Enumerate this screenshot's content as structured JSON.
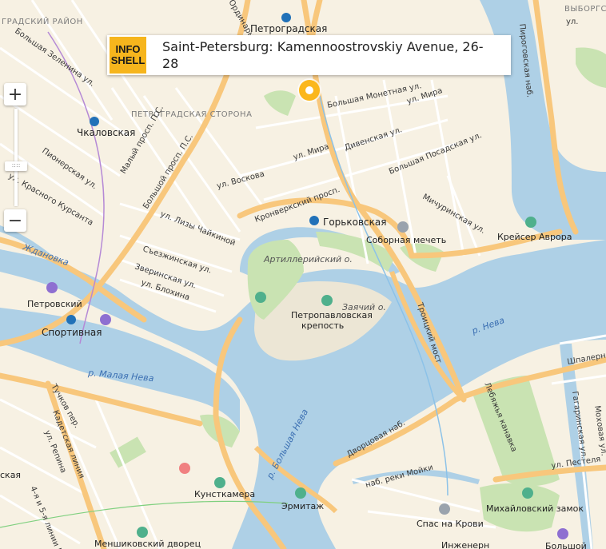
{
  "info_card": {
    "logo_line1": "INFO",
    "logo_line2": "SHELL",
    "title": "Saint-Petersburg: Kamennoostrovskiy Avenue, 26-28"
  },
  "zoom": {
    "plus": "+",
    "minus": "−",
    "handle": "::::"
  },
  "colors": {
    "land": "#f7f1e3",
    "water": "#aed0e6",
    "park": "#c9e3b2",
    "road_major": "#f8c77c",
    "road_minor": "#ffffff",
    "marker": "#fbb71c",
    "logo": "#f6b51d"
  },
  "labels": {
    "district_top": "ГРАДСКИЙ РАЙОН",
    "district_vyborg": "ВЫБОРГСК",
    "district_petrograd": "ПЕТРОГРАДСКАЯ СТОРОНА",
    "metro_petrogradskaya": "Петроградская",
    "metro_chkalovskaya": "Чкаловская",
    "metro_gorkovskaya": "Горьковская",
    "metro_sportivnaya": "Спортивная",
    "petrovsky": "Петровский",
    "street_bolshaya_zelenina": "Большая Зеленина ул.",
    "street_bolshoy_pr": "Большой просп. П.С.",
    "street_pionerskaya": "Пионерская ул.",
    "street_krasnogo_kursanta": "ул. Красного Курсанта",
    "street_maly_pr": "Малый просп. П.С.",
    "street_voskova": "ул. Воскова",
    "street_mira1": "ул. Мира",
    "street_mira2": "ул. Мира",
    "street_bolshaya_monetnaya": "Большая Монетная ул.",
    "street_divenskaya": "Дивенская ул.",
    "street_bolshaya_posadskaya": "Большая Посадская ул.",
    "street_michurinskaya": "Мичуринская ул.",
    "street_kronverksky": "Кронверкский просп.",
    "street_lizy_chaykinoy": "ул. Лизы Чайкиной",
    "street_sezzhinskaya": "Съезжинская ул.",
    "street_zverinskaya": "Зверинская ул.",
    "street_blokhina": "ул. Блохина",
    "street_pirogovskaya": "Пироговская наб.",
    "street_troitsky": "Троицкий мост",
    "street_dvortsovaya": "Дворцовая наб.",
    "street_kadetskaya": "Кадетская линия",
    "street_repina": "ул. Репина",
    "street_tuchkov": "Тучков пер.",
    "street_linii": "4-я и 5-я линии В.О.",
    "street_moyki": "наб. реки Мойки",
    "street_pestelya": "ул. Пестеля",
    "street_lebyazhya": "Лебяжья канавка",
    "street_shpalernaya": "Шпалерн",
    "street_gagarinskaya": "Гагаринская ул.",
    "street_mokhovaya": "Моховая ул.",
    "street_ordinarnaya": "Ординарная",
    "street_vyborg_fragment": "ул.",
    "water_malaya_neva": "р. Малая Нева",
    "water_bolshaya_neva": "р. Большая Нева",
    "water_neva": "р. Нева",
    "water_zhdanovka": "Ждановка",
    "island_artilleriysky": "Артиллерийский о.",
    "island_zayachiy": "Заячий о.",
    "poi_petropavlovskaya": "Петропавловская",
    "poi_krepost": "крепость",
    "poi_mechet": "Соборная мечеть",
    "poi_avrora": "Крейсер Аврора",
    "poi_kunstkamera": "Кунсткамера",
    "poi_ermitazh": "Эрмитаж",
    "poi_spas": "Спас на Крови",
    "poi_mikhailovsky": "Михайловский замок",
    "poi_menshikovsky": "Меншиковский дворец",
    "poi_bolshoy": "Большой",
    "poi_inzhenernaya": "Инженерн",
    "poi_left_edge": "ская"
  }
}
